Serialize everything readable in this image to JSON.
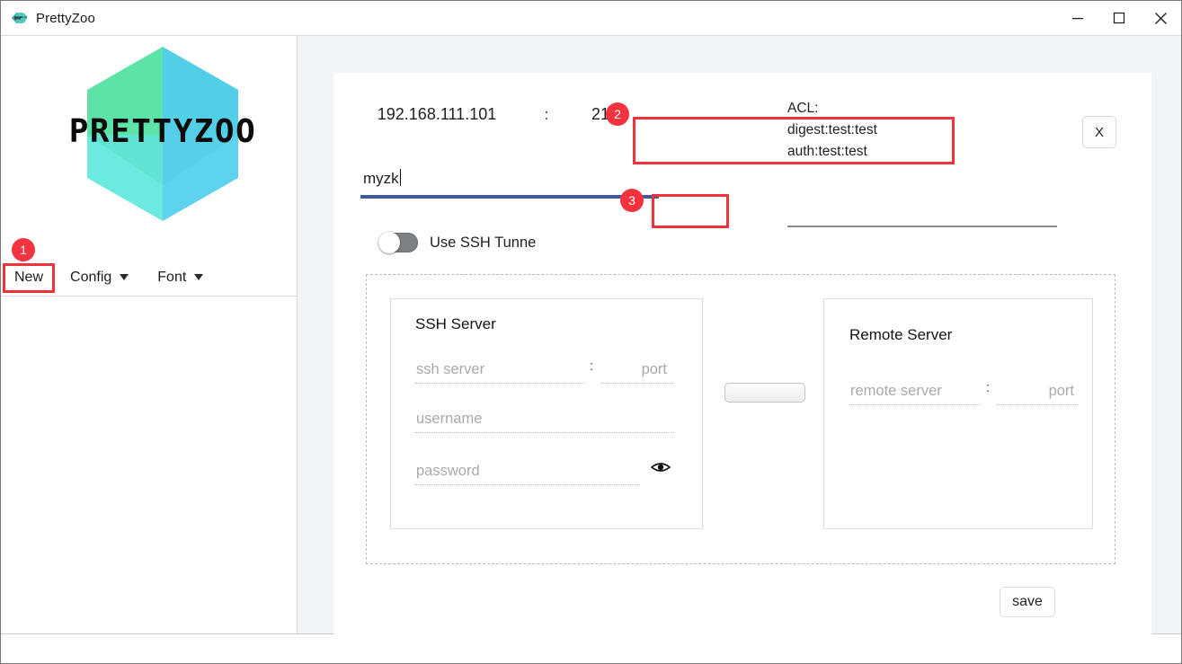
{
  "window": {
    "title": "PrettyZoo",
    "icon": "prettyzoo-logo-icon",
    "minimize_label": "minimize-icon",
    "maximize_label": "maximize-icon",
    "close_label": "close-icon"
  },
  "sidebar": {
    "logo_text": "PRETTYZOO",
    "menu": [
      {
        "label": "New",
        "has_caret": false
      },
      {
        "label": "Config",
        "has_caret": true
      },
      {
        "label": "Font",
        "has_caret": true
      }
    ]
  },
  "connection": {
    "host": "192.168.111.101",
    "port": "2181",
    "colon": ":",
    "name_value": "myzk",
    "acl_label": "ACL:",
    "acl_entries": [
      "digest:test:test",
      "auth:test:test"
    ],
    "clear_acl_label": "X",
    "ssh_toggle_label": "Use SSH Tunne",
    "ssh_toggle_state": "off"
  },
  "ssh_server": {
    "title": "SSH Server",
    "host_placeholder": "ssh server",
    "colon": ":",
    "port_placeholder": "port",
    "username_placeholder": "username",
    "password_placeholder": "password",
    "reveal_icon": "eye-icon"
  },
  "remote_server": {
    "title": "Remote Server",
    "host_placeholder": "remote server",
    "colon": ":",
    "port_placeholder": "port"
  },
  "actions": {
    "save_label": "save",
    "connector_label": ""
  },
  "annotations": [
    {
      "number": "1"
    },
    {
      "number": "2"
    },
    {
      "number": "3"
    }
  ],
  "colors": {
    "annotation_red": "#f0323a",
    "focus_underline_blue": "#4157a0",
    "panel_background": "#f1f5f8",
    "logo_green": "#5fe0a8",
    "logo_cyan": "#5ed7ea"
  }
}
